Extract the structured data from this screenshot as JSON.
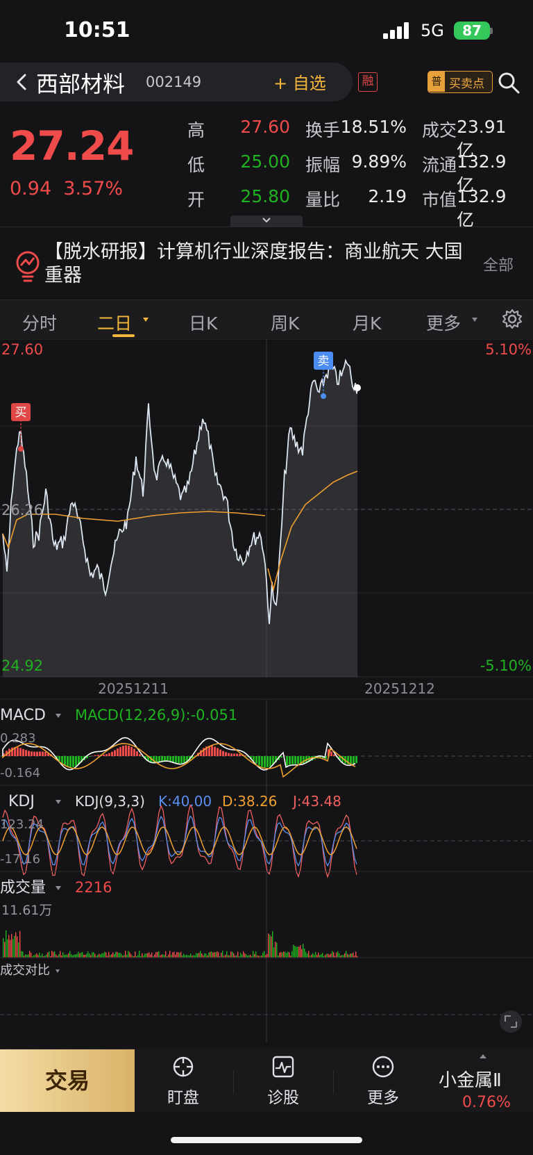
{
  "status_bar": {
    "time": "10:51",
    "network": "5G",
    "battery": "87"
  },
  "header": {
    "stock_name": "西部材料",
    "stock_code": "002149",
    "watch_label": "+ 自选",
    "margin_badge": "融",
    "signal_tag": "普",
    "signal_label": "买卖点"
  },
  "quote": {
    "price": "27.24",
    "change": "0.94",
    "change_pct": "3.57%",
    "stats": [
      {
        "label": "高",
        "value": "27.60",
        "color": "red"
      },
      {
        "label": "低",
        "value": "25.00",
        "color": "green"
      },
      {
        "label": "开",
        "value": "25.80",
        "color": "green"
      }
    ],
    "metrics": [
      {
        "label": "换手",
        "value": "18.51%"
      },
      {
        "label": "振幅",
        "value": "9.89%"
      },
      {
        "label": "量比",
        "value": "2.19"
      }
    ],
    "totals": [
      {
        "label": "成交",
        "value": "23.91亿"
      },
      {
        "label": "流通",
        "value": "132.9亿"
      },
      {
        "label": "市值",
        "value": "132.9亿"
      }
    ]
  },
  "news": {
    "text": "【脱水研报】计算机行业深度报告：商业航天 大国重器",
    "all_label": "全部"
  },
  "tabs": [
    {
      "label": "分时"
    },
    {
      "label": "二日"
    },
    {
      "label": "日K"
    },
    {
      "label": "周K"
    },
    {
      "label": "月K"
    },
    {
      "label": "更多"
    }
  ],
  "price_chart": {
    "high_label": "27.60",
    "low_label": "24.92",
    "mid_label": "26.26",
    "pct_high": "5.10%",
    "pct_low": "-5.10%",
    "dates": [
      "20251211",
      "20251212"
    ],
    "buy_marker": "买",
    "sell_marker": "卖"
  },
  "macd": {
    "name": "MACD",
    "params": "MACD(12,26,9):-0.051",
    "top_label": "0.283",
    "bottom_label": "-0.164"
  },
  "kdj": {
    "name": "KDJ",
    "params": "KDJ(9,3,3)",
    "k": "K:40.00",
    "d": "D:38.26",
    "j": "J:43.48",
    "top_label": "123.24",
    "bottom_label": "-17.16"
  },
  "volume": {
    "name": "成交量",
    "value": "2216",
    "max_label": "11.61万"
  },
  "compare": {
    "name": "成交对比"
  },
  "bottom_nav": {
    "trade": "交易",
    "items": [
      {
        "label": "盯盘"
      },
      {
        "label": "诊股"
      },
      {
        "label": "更多"
      }
    ],
    "sector_name": "小金属Ⅱ",
    "sector_change": "0.76%"
  },
  "colors": {
    "up": "#f04b4b",
    "down": "#1fb31f",
    "accent": "#f5b73b",
    "avg_line": "#f0a030",
    "kdj_k": "#5b8ff0",
    "kdj_d": "#f0a030",
    "kdj_j": "#f06060"
  }
}
